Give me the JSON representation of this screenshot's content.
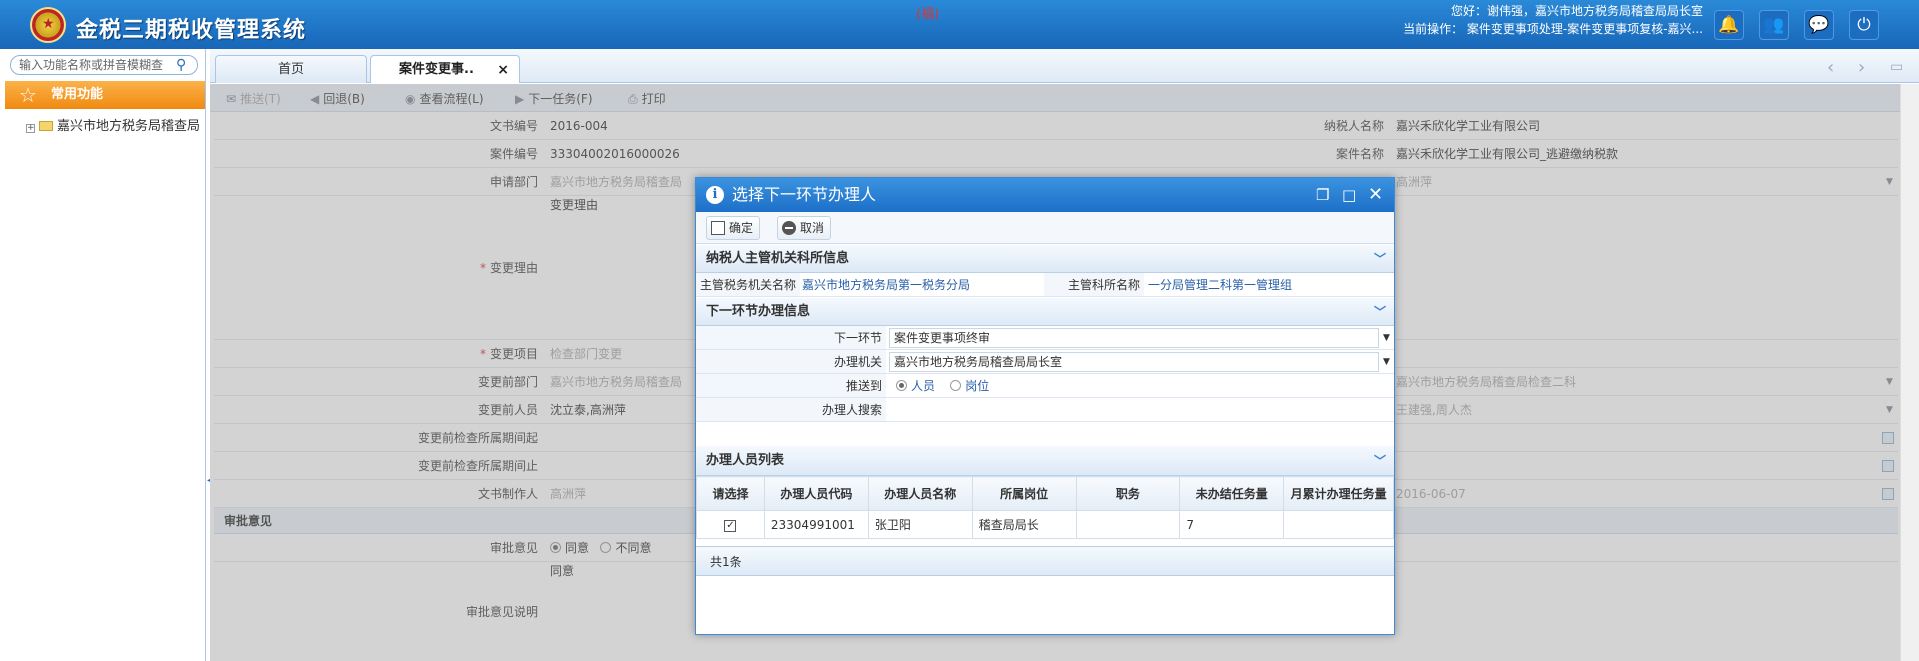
{
  "header": {
    "app_title": "金税三期税收管理系统",
    "center_mark": "(福)",
    "greeting": "您好：谢伟强，嘉兴市地方税务局稽查局局长室",
    "current_operation": "当前操作： 案件变更事项处理-案件变更事项复核-嘉兴..."
  },
  "sidebar": {
    "search_placeholder": "输入功能名称或拼音模糊查",
    "favorites_label": "常用功能",
    "tree_root": "嘉兴市地方税务局稽查局"
  },
  "tabs": [
    {
      "label": "首页"
    },
    {
      "label": "案件变更事..",
      "close": "×"
    }
  ],
  "toolbar": {
    "push": "推送(T)",
    "return": "回退(B)",
    "view_flow": "查看流程(L)",
    "next_task": "下一任务(F)",
    "print": "打印"
  },
  "form": {
    "doc_no_label": "文书编号",
    "doc_no": "2016-004",
    "taxpayer_label": "纳税人名称",
    "taxpayer": "嘉兴禾欣化学工业有限公司",
    "case_no_label": "案件编号",
    "case_no": "33304002016000026",
    "case_name_label": "案件名称",
    "case_name": "嘉兴禾欣化学工业有限公司_逃避缴纳税款",
    "apply_dept_label": "申请部门",
    "apply_dept": "嘉兴市地方税务局稽查局",
    "apply_person": "高洲萍",
    "reason_label": "变更理由",
    "reason": "变更理由",
    "item_label": "变更项目",
    "item": "检查部门变更",
    "before_dept_label": "变更前部门",
    "before_dept": "嘉兴市地方税务局稽查局",
    "after_dept": "嘉兴市地方税务局稽查局检查二科",
    "before_person_label": "变更前人员",
    "before_person": "沈立泰,高洲萍",
    "after_person": "王建强,周人杰",
    "period_start_label": "变更前检查所属期间起",
    "period_end_label": "变更前检查所属期间止",
    "maker_label": "文书制作人",
    "maker": "高洲萍",
    "date": "2016-06-07",
    "approval_section": "审批意见",
    "approval_label": "审批意见",
    "agree": "同意",
    "disagree": "不同意",
    "approval_note_label": "审批意见说明",
    "approval_note": "同意"
  },
  "dialog": {
    "title": "选择下一环节办理人",
    "ok": "确定",
    "cancel": "取消",
    "section1": "纳税人主管机关科所信息",
    "tax_office_label": "主管税务机关名称",
    "tax_office": "嘉兴市地方税务局第一税务分局",
    "section_office_label": "主管科所名称",
    "section_office": "一分局管理二科第一管理组",
    "section2": "下一环节办理信息",
    "next_step_label": "下一环节",
    "next_step": "案件变更事项终审",
    "handling_org_label": "办理机关",
    "handling_org": "嘉兴市地方税务局稽查局局长室",
    "push_to_label": "推送到",
    "push_person": "人员",
    "push_post": "岗位",
    "handler_search_label": "办理人搜索",
    "section3": "办理人员列表",
    "columns": [
      "请选择",
      "办理人员代码",
      "办理人员名称",
      "所属岗位",
      "职务",
      "未办结任务量",
      "月累计办理任务量"
    ],
    "rows": [
      {
        "checked": "✓",
        "code": "23304991001",
        "name": "张卫阳",
        "post": "稽查局局长",
        "title": "",
        "pending": "7",
        "monthly": ""
      }
    ],
    "total": "共1条"
  }
}
